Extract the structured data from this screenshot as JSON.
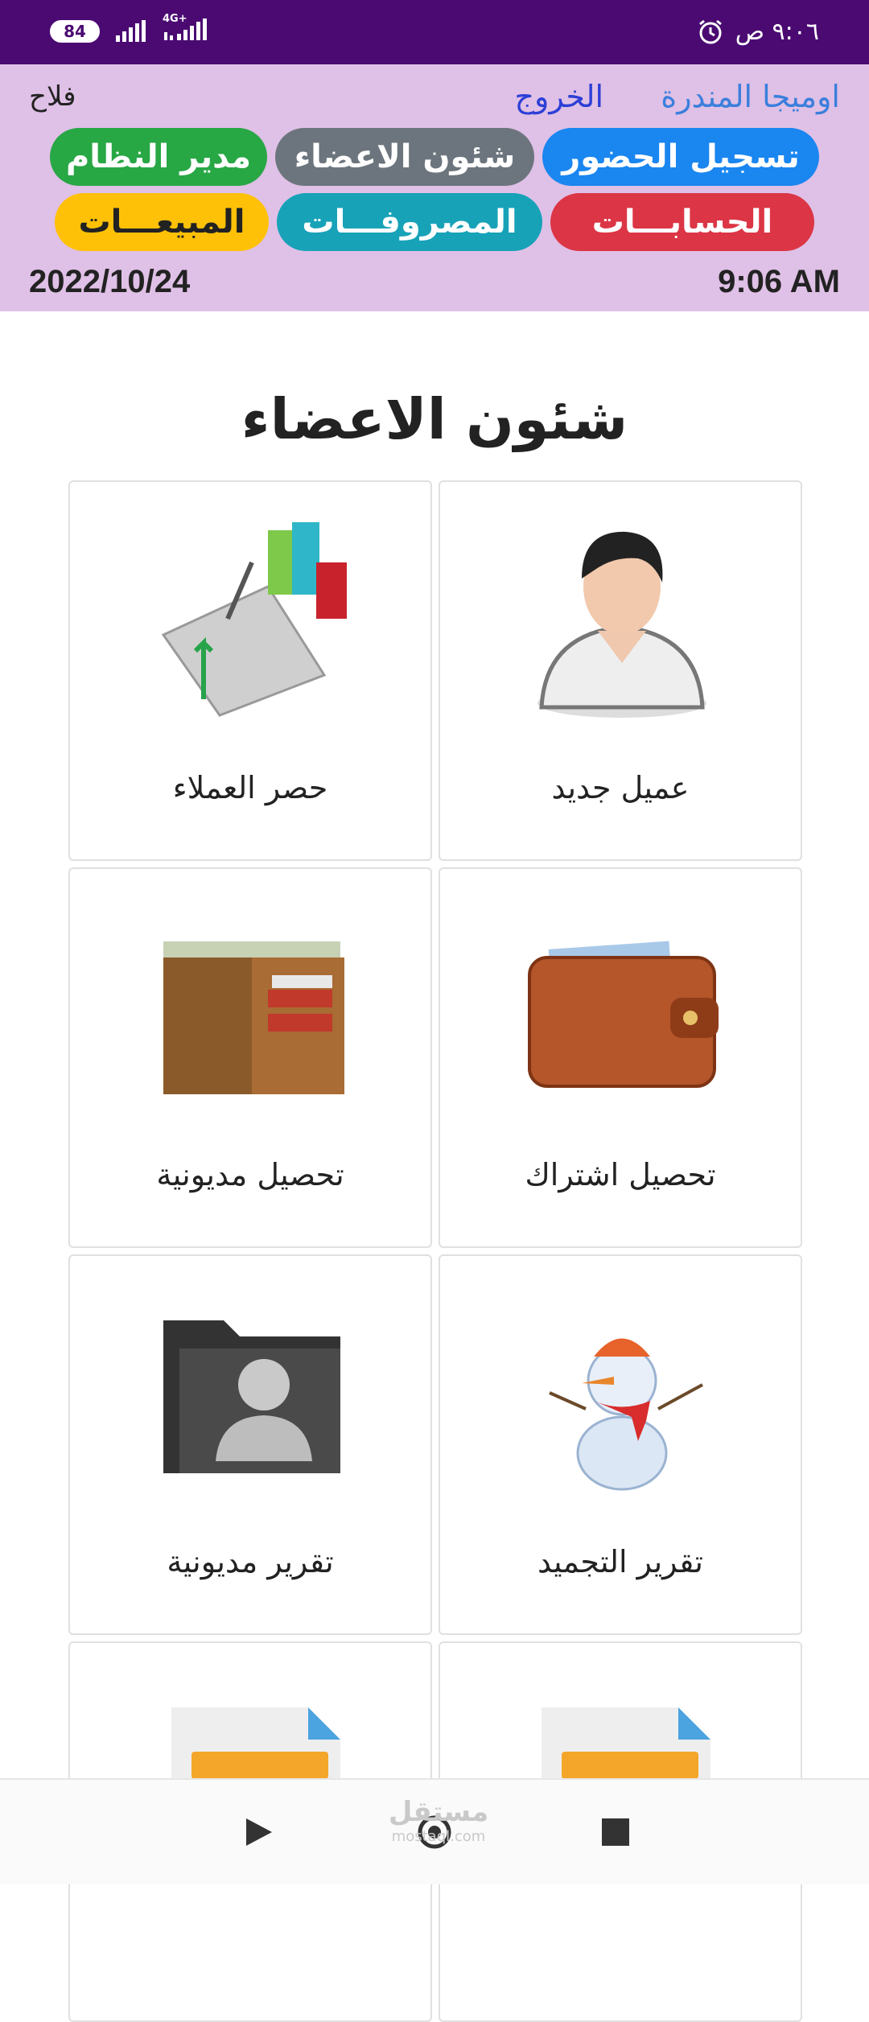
{
  "status_bar": {
    "battery": "84",
    "network": "4G+",
    "time": "٩:٠٦ ص"
  },
  "header": {
    "brand": "اوميجا المندرة",
    "logout": "الخروج",
    "user": "فلاح",
    "date": "2022/10/24",
    "time": "9:06 AM",
    "menu": [
      {
        "label": "تسجيل الحضور",
        "color": "#1a86f0"
      },
      {
        "label": "شئون الاعضاء",
        "color": "#6c757d"
      },
      {
        "label": "مدير النظام",
        "color": "#28a745"
      },
      {
        "label": "الحسابـــات",
        "color": "#dc3545"
      },
      {
        "label": "المصروفـــات",
        "color": "#17a2b8"
      },
      {
        "label": "المبيعـــات",
        "color": "#ffc107"
      }
    ]
  },
  "main": {
    "title": "شئون الاعضاء",
    "tiles": [
      {
        "label": "عميل جديد",
        "icon": "user-avatar-icon"
      },
      {
        "label": "حصر العملاء",
        "icon": "chart-report-icon"
      },
      {
        "label": "تحصيل اشتراك",
        "icon": "closed-wallet-icon"
      },
      {
        "label": "تحصيل مديونية",
        "icon": "open-wallet-icon"
      },
      {
        "label": "تقرير التجميد",
        "icon": "snowman-icon"
      },
      {
        "label": "تقرير مديونية",
        "icon": "user-folder-icon"
      },
      {
        "label": "",
        "icon": "document-icon"
      },
      {
        "label": "",
        "icon": "document-icon"
      }
    ]
  },
  "watermark": {
    "main": "مستقل",
    "sub": "mostaql.com"
  }
}
